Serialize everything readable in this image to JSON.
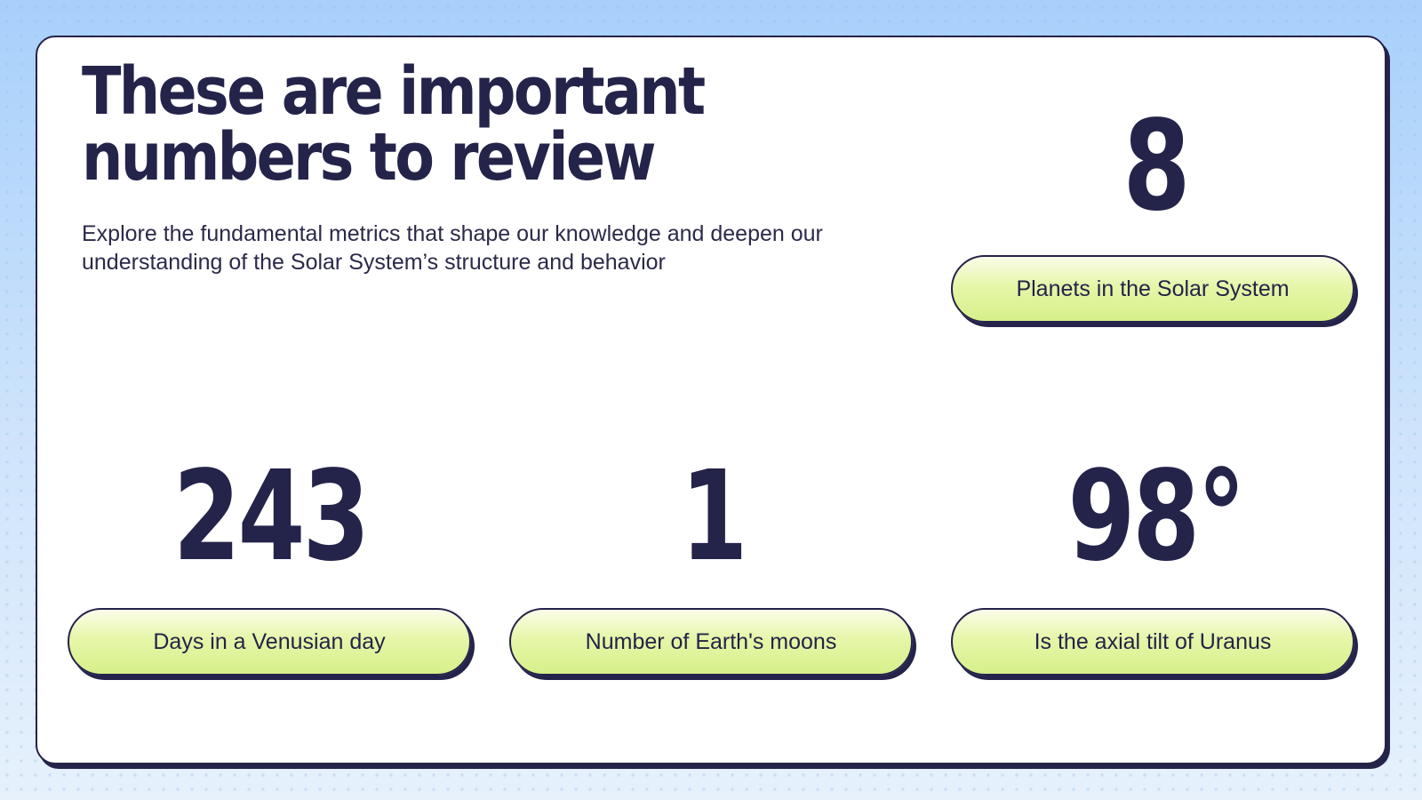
{
  "header": {
    "title": "These are important\nnumbers to review",
    "subtitle": "Explore the fundamental metrics that shape our knowledge and deepen our understanding of the Solar System’s structure and behavior"
  },
  "stats": [
    {
      "number": "8",
      "label": "Planets in the Solar System"
    },
    {
      "number": "243",
      "label": "Days in a Venusian day"
    },
    {
      "number": "1",
      "label": "Number of Earth's moons"
    },
    {
      "number": "98°",
      "label": "Is the axial tilt of Uranus"
    }
  ],
  "colors": {
    "ink": "#24234a",
    "pill_fill": "#e6f6a9",
    "background": "#cfe4fb"
  }
}
